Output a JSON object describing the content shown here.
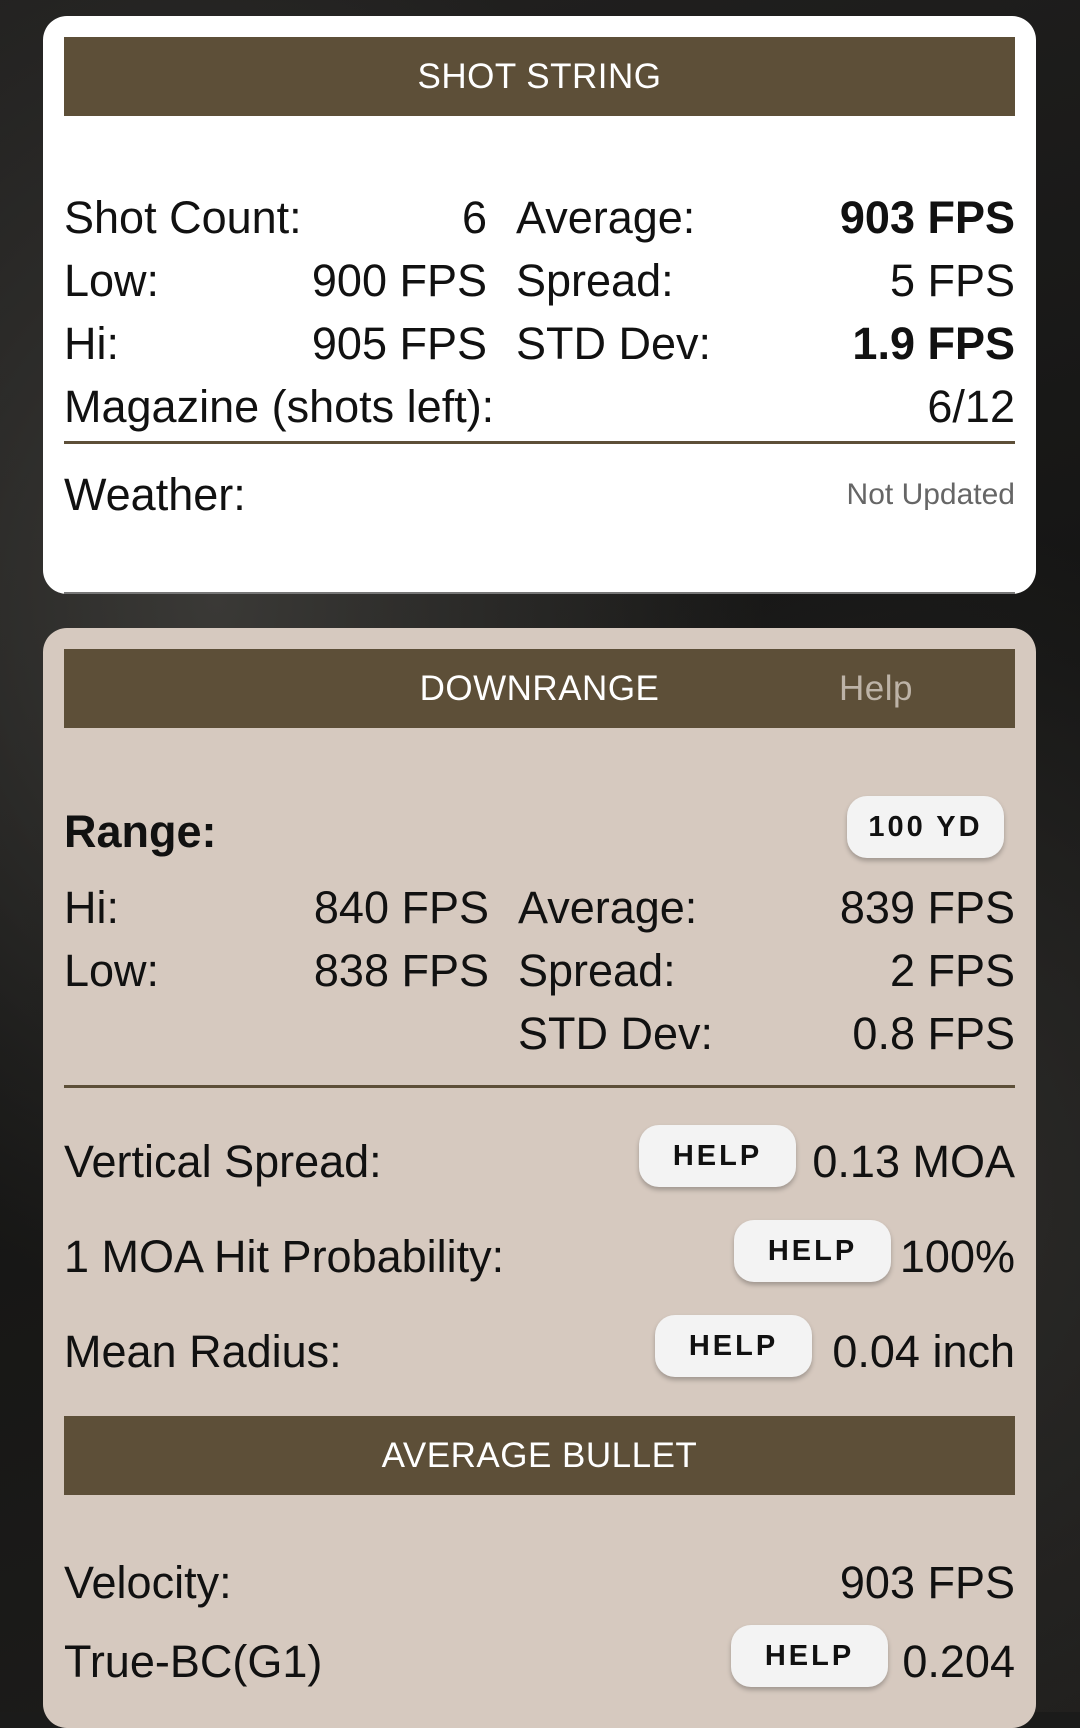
{
  "shot_string": {
    "header": "SHOT STRING",
    "shot_count_label": "Shot Count:",
    "shot_count_value": "6",
    "average_label": "Average:",
    "average_value": "903 FPS",
    "low_label": "Low:",
    "low_value": "900 FPS",
    "spread_label": "Spread:",
    "spread_value": "5 FPS",
    "hi_label": "Hi:",
    "hi_value": "905 FPS",
    "std_label": "STD Dev:",
    "std_value": "1.9 FPS",
    "magazine_label": "Magazine (shots left):",
    "magazine_value": "6/12",
    "weather_label": "Weather:",
    "weather_value": "Not Updated"
  },
  "downrange": {
    "header": "DOWNRANGE",
    "help_link": "Help",
    "range_label": "Range:",
    "range_button": "100 YD",
    "hi_label": "Hi:",
    "hi_value": "840 FPS",
    "average_label": "Average:",
    "average_value": "839 FPS",
    "low_label": "Low:",
    "low_value": "838 FPS",
    "spread_label": "Spread:",
    "spread_value": "2 FPS",
    "std_label": "STD Dev:",
    "std_value": "0.8 FPS",
    "vertical_spread_label": "Vertical Spread:",
    "vertical_spread_value": "0.13 MOA",
    "hit_probability_label": "1 MOA Hit Probability:",
    "hit_probability_value": "100%",
    "mean_radius_label": "Mean Radius:",
    "mean_radius_value": "0.04 inch",
    "help_button": "HELP"
  },
  "average_bullet": {
    "header": "AVERAGE BULLET",
    "velocity_label": "Velocity:",
    "velocity_value": "903 FPS",
    "bc_label": "True-BC(G1)",
    "bc_value": "0.204"
  },
  "colors": {
    "header_bar": "#5d4f38",
    "tan_card": "#d6c9bf",
    "white_card": "#ffffff"
  }
}
